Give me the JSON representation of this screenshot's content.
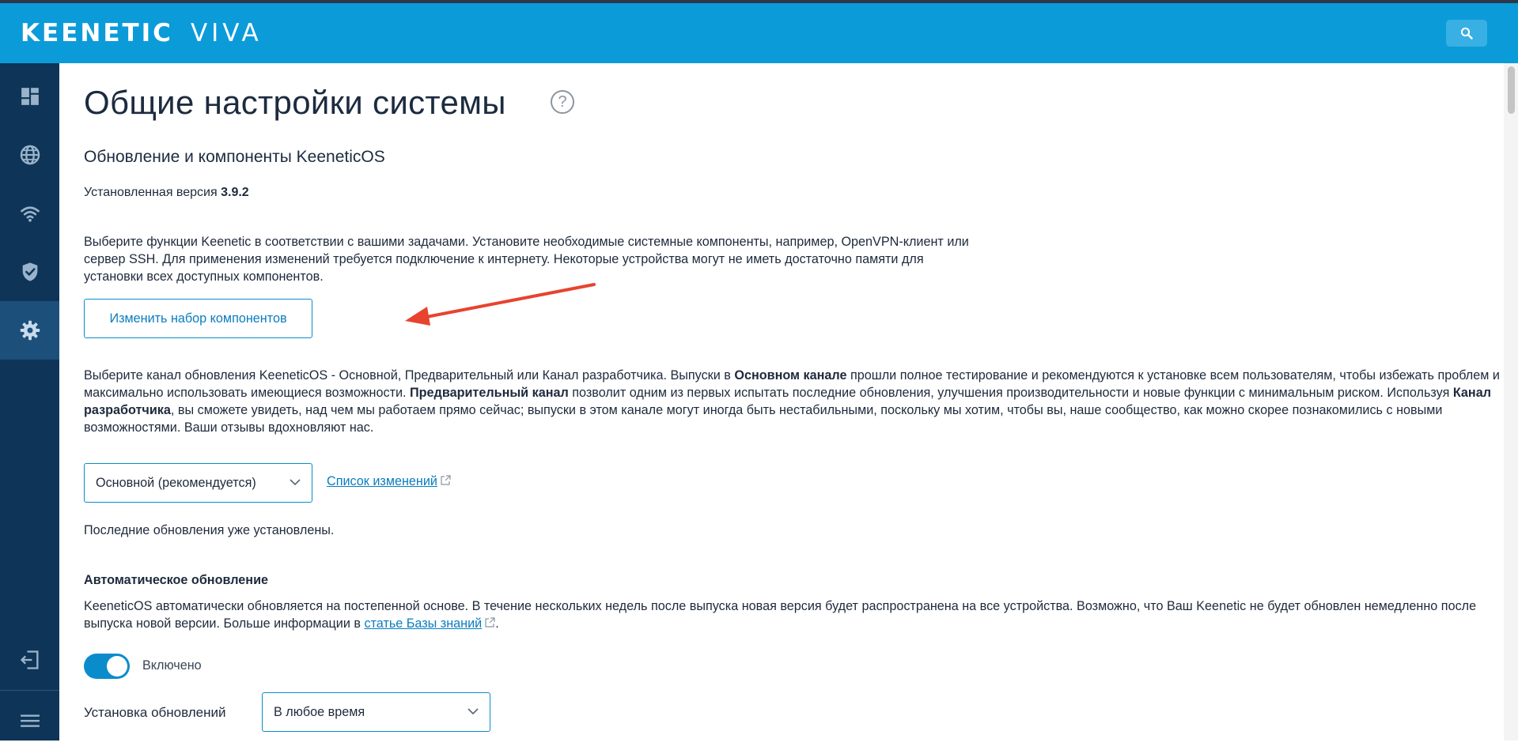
{
  "header": {
    "brand_name": "KEENETIC",
    "brand_model": "VIVA",
    "icons": {
      "search": "search-icon"
    }
  },
  "sidebar": {
    "items": [
      {
        "icon": "dashboard-icon",
        "active": false
      },
      {
        "icon": "globe-icon",
        "active": false
      },
      {
        "icon": "wifi-icon",
        "active": false
      },
      {
        "icon": "shield-check-icon",
        "active": false
      },
      {
        "icon": "gear-icon",
        "active": true
      }
    ],
    "bottom_items": [
      {
        "icon": "logout-icon"
      },
      {
        "icon": "menu-icon"
      }
    ]
  },
  "page": {
    "title": "Общие настройки системы",
    "help_symbol": "?",
    "section_title": "Обновление и компоненты KeeneticOS",
    "version_label": "Установленная версия",
    "version_value": "3.9.2",
    "components_paragraph": [
      "Выберите функции Keenetic в соответствии с вашими задачами. Установите необходимые системные компоненты, например, OpenVPN-клиент или",
      "сервер SSH. Для применения изменений требуется подключение к интернету. Некоторые устройства могут не иметь достаточно памяти для",
      "установки всех доступных компонентов."
    ],
    "change_components_button": "Изменить набор компонентов",
    "channel_paragraph": {
      "t1": "Выберите канал обновления KeeneticOS - Основной, Предварительный или Канал разработчика. Выпуски в ",
      "b1": "Основном канале",
      "t2": " прошли полное тестирование и рекомендуются к установке всем пользователям, чтобы избежать проблем и максимально использовать имеющиеся возможности. ",
      "b2": "Предварительный канал",
      "t3": " позволит одним из первых испытать последние обновления, улучшения производительности и новые функции с минимальным риском. Используя ",
      "b3": "Канал разработчика",
      "t4": ", вы сможете увидеть, над чем мы работаем прямо сейчас; выпуски в этом канале могут иногда быть нестабильными, поскольку мы хотим, чтобы вы, наше сообщество, как можно скорее познакомились с новыми возможностями. Ваши отзывы вдохновляют нас."
    },
    "channel_select_value": "Основной (рекомендуется)",
    "changelog_link": "Список изменений",
    "status_text": "Последние обновления уже установлены.",
    "auto_update": {
      "title": "Автоматическое обновление",
      "description_1": "KeeneticOS автоматически обновляется на постепенной основе. В течение нескольких недель после выпуска новая версия будет распространена на все устройства. Возможно, что Ваш Keenetic не будет обновлен немедленно после выпуска новой версии. Больше информации в ",
      "link": "статье Базы знаний",
      "description_2": ".",
      "toggle_label": "Включено",
      "toggle_on": true
    },
    "install_updates": {
      "label": "Установка обновлений",
      "value": "В любое время"
    }
  },
  "colors": {
    "header": "#0b9bd9",
    "sidebar": "#0e3558",
    "sidebar_active": "#1c4f7a",
    "accent": "#0a8ccc",
    "annotation_arrow": "#e8432e"
  }
}
